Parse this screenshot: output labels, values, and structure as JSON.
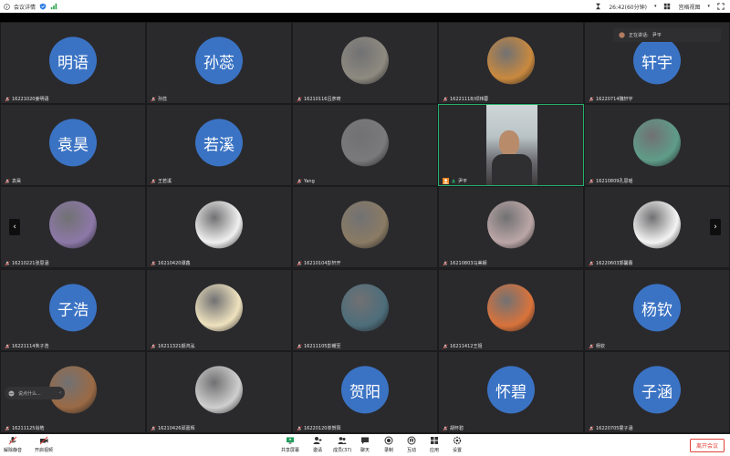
{
  "topbar": {
    "meeting_details": "会议详情",
    "timer": "26:42(60分钟)",
    "view_mode": "宫格视图"
  },
  "speaking": {
    "label": "正在讲话:",
    "name": "尹平"
  },
  "chat": {
    "placeholder": "说点什么..."
  },
  "tiles": [
    {
      "name": "16221020姜明语",
      "avatar_text": "明语",
      "type": "text"
    },
    {
      "name": "孙蕊",
      "avatar_text": "孙蕊",
      "type": "text"
    },
    {
      "name": "16210116吕彦琦",
      "type": "photo",
      "photo_color": "#8e8a80"
    },
    {
      "name": "16221118/邓玮蓉",
      "type": "photo",
      "photo_color": "#c9893e"
    },
    {
      "name": "16220714魏轩宇",
      "avatar_text": "轩宇",
      "type": "text"
    },
    {
      "name": "袁昊",
      "avatar_text": "袁昊",
      "type": "text"
    },
    {
      "name": "王若溪",
      "avatar_text": "若溪",
      "type": "text"
    },
    {
      "name": "Yang",
      "type": "photo",
      "photo_color": "#7a7a7c"
    },
    {
      "name": "尹平",
      "type": "video"
    },
    {
      "name": "16210809孔思瑶",
      "type": "photo",
      "photo_color": "#5f9c88"
    },
    {
      "name": "16210221张思涵",
      "type": "photo",
      "photo_color": "#8d78a8"
    },
    {
      "name": "16210420谭鑫",
      "type": "photo",
      "photo_color": "#f0f0f0"
    },
    {
      "name": "16210104彭轩开",
      "type": "photo",
      "photo_color": "#8a7b64"
    },
    {
      "name": "16210803马美娴",
      "type": "photo",
      "photo_color": "#bba6a6"
    },
    {
      "name": "16220603郭馨蕾",
      "type": "photo",
      "photo_color": "#f4f4f4"
    },
    {
      "name": "16221114朱子浩",
      "avatar_text": "子浩",
      "type": "text"
    },
    {
      "name": "16211321颜鸿泓",
      "type": "photo",
      "photo_color": "#efe2be"
    },
    {
      "name": "16211105彭耀至",
      "type": "photo",
      "photo_color": "#4d6d7a"
    },
    {
      "name": "16211412王祖",
      "type": "photo",
      "photo_color": "#d9733b"
    },
    {
      "name": "杨钦",
      "avatar_text": "杨钦",
      "type": "text"
    },
    {
      "name": "16211125肖皓",
      "type": "photo",
      "photo_color": "#9a6a45"
    },
    {
      "name": "16210426邱嘉辉",
      "type": "photo",
      "photo_color": "#cfcfcf"
    },
    {
      "name": "16220120单贺阳",
      "avatar_text": "贺阳",
      "type": "text"
    },
    {
      "name": "胡怀碧",
      "avatar_text": "怀碧",
      "type": "text"
    },
    {
      "name": "16220705霍子涵",
      "avatar_text": "子涵",
      "type": "text"
    }
  ],
  "toolbar": {
    "mute": "解除静音",
    "video": "开启视频",
    "share": "共享屏幕",
    "invite": "邀请",
    "members": "成员(37)",
    "chat": "聊天",
    "record": "录制",
    "interact": "互动",
    "apps": "应用",
    "settings": "设置",
    "end": "离开会议"
  },
  "colors": {
    "avatar_blue": "#3b73c4",
    "active_border": "#23b06a",
    "end_red": "#e2433a"
  }
}
